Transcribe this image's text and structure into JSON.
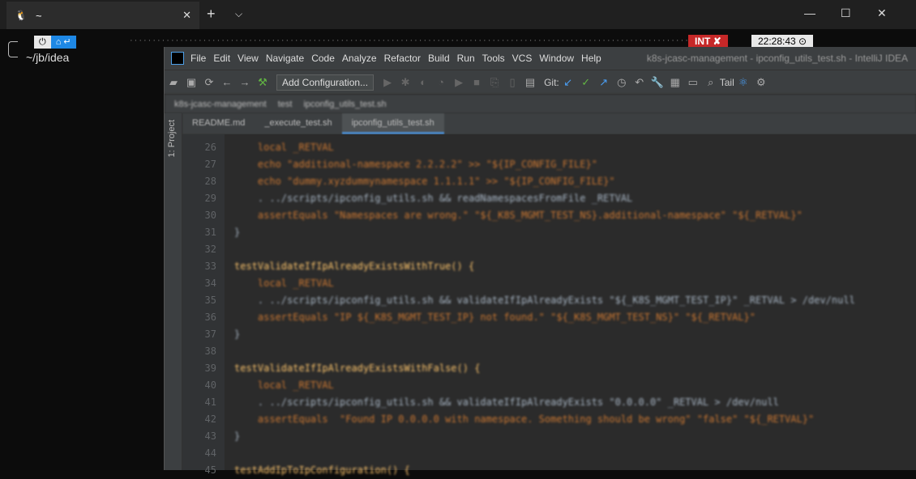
{
  "terminal": {
    "tab_title": "~",
    "cwd": "~/jb/idea",
    "status_int": "INT ✘",
    "clock": "22:28:43 ⊙",
    "home_segment": "⌂ ↵"
  },
  "ide": {
    "menu": [
      "File",
      "Edit",
      "View",
      "Navigate",
      "Code",
      "Analyze",
      "Refactor",
      "Build",
      "Run",
      "Tools",
      "VCS",
      "Window",
      "Help"
    ],
    "window_title": "k8s-jcasc-management - ipconfig_utils_test.sh - IntelliJ IDEA",
    "add_config": "Add Configuration...",
    "git_label": "Git:",
    "tail_label": "Tail",
    "breadcrumb": [
      "k8s-jcasc-management",
      "test",
      "ipconfig_utils_test.sh"
    ],
    "project_tab": "1: Project",
    "tabs": [
      "README.md",
      "_execute_test.sh",
      "ipconfig_utils_test.sh"
    ],
    "code_lines": [
      {
        "n": "26",
        "t": "    local _RETVAL"
      },
      {
        "n": "27",
        "t": "    echo \"additional-namespace 2.2.2.2\" >> \"${IP_CONFIG_FILE}\""
      },
      {
        "n": "28",
        "t": "    echo \"dummy.xyzdummynamespace 1.1.1.1\" >> \"${IP_CONFIG_FILE}\""
      },
      {
        "n": "29",
        "t": "    . ../scripts/ipconfig_utils.sh && readNamespacesFromFile _RETVAL"
      },
      {
        "n": "30",
        "t": "    assertEquals \"Namespaces are wrong.\" \"${_K8S_MGMT_TEST_NS}.additional-namespace\" \"${_RETVAL}\""
      },
      {
        "n": "31",
        "t": "}"
      },
      {
        "n": "32",
        "t": ""
      },
      {
        "n": "33",
        "t": "testValidateIfIpAlreadyExistsWithTrue() {"
      },
      {
        "n": "34",
        "t": "    local _RETVAL"
      },
      {
        "n": "35",
        "t": "    . ../scripts/ipconfig_utils.sh && validateIfIpAlreadyExists \"${_K8S_MGMT_TEST_IP}\" _RETVAL > /dev/null"
      },
      {
        "n": "36",
        "t": "    assertEquals \"IP ${_K8S_MGMT_TEST_IP} not found.\" \"${_K8S_MGMT_TEST_NS}\" \"${_RETVAL}\""
      },
      {
        "n": "37",
        "t": "}"
      },
      {
        "n": "38",
        "t": ""
      },
      {
        "n": "39",
        "t": "testValidateIfIpAlreadyExistsWithFalse() {"
      },
      {
        "n": "40",
        "t": "    local _RETVAL"
      },
      {
        "n": "41",
        "t": "    . ../scripts/ipconfig_utils.sh && validateIfIpAlreadyExists \"0.0.0.0\" _RETVAL > /dev/null"
      },
      {
        "n": "42",
        "t": "    assertEquals  \"Found IP 0.0.0.0 with namespace. Something should be wrong\" \"false\" \"${_RETVAL}\""
      },
      {
        "n": "43",
        "t": "}"
      },
      {
        "n": "44",
        "t": ""
      },
      {
        "n": "45",
        "t": "testAddIpToIpConfiguration() {"
      }
    ],
    "colors": {
      "keyword": "#cc7832",
      "string": "#6a8759",
      "func": "#ffc66d",
      "var": "#9876aa",
      "text": "#a9b7c6"
    }
  }
}
